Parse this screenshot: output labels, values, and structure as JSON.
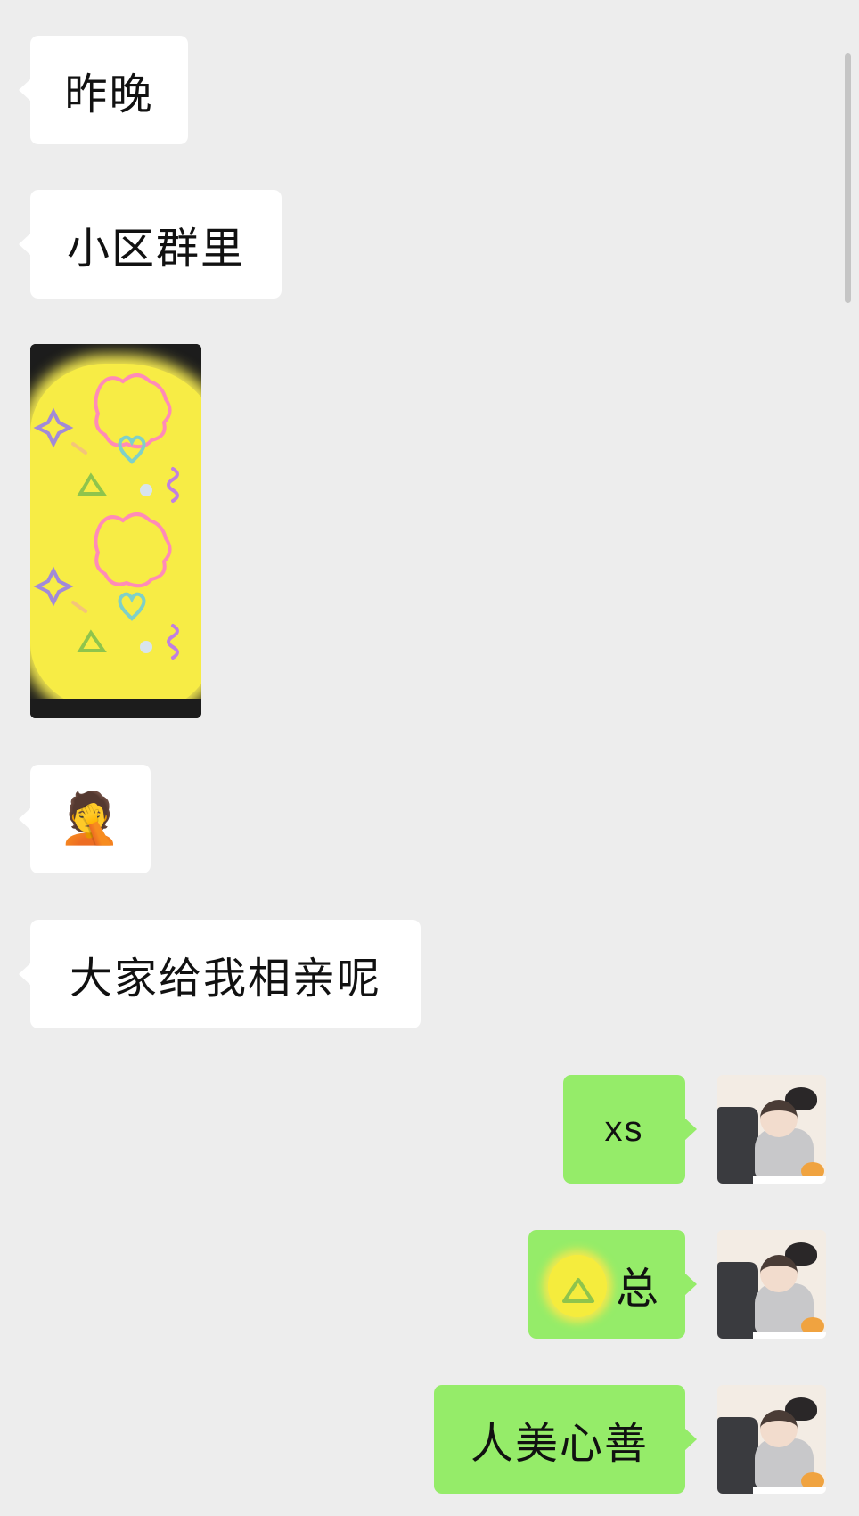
{
  "chat": {
    "messages": [
      {
        "direction": "incoming",
        "text": "昨晚"
      },
      {
        "direction": "incoming",
        "text": "小区群里"
      },
      {
        "direction": "incoming",
        "type": "image"
      },
      {
        "direction": "incoming",
        "type": "emoji",
        "text": "🤦"
      },
      {
        "direction": "incoming",
        "text": "大家给我相亲呢"
      },
      {
        "direction": "outgoing",
        "text": "xs"
      },
      {
        "direction": "outgoing",
        "text": "总"
      },
      {
        "direction": "outgoing",
        "text": "人美心善"
      }
    ]
  },
  "colors": {
    "background": "#ededed",
    "incoming_bubble": "#ffffff",
    "outgoing_bubble": "#95ec69",
    "sticker_yellow": "#f7ec45"
  },
  "icons": {
    "emoji": "facepalm-emoji",
    "avatar": "user-avatar"
  }
}
